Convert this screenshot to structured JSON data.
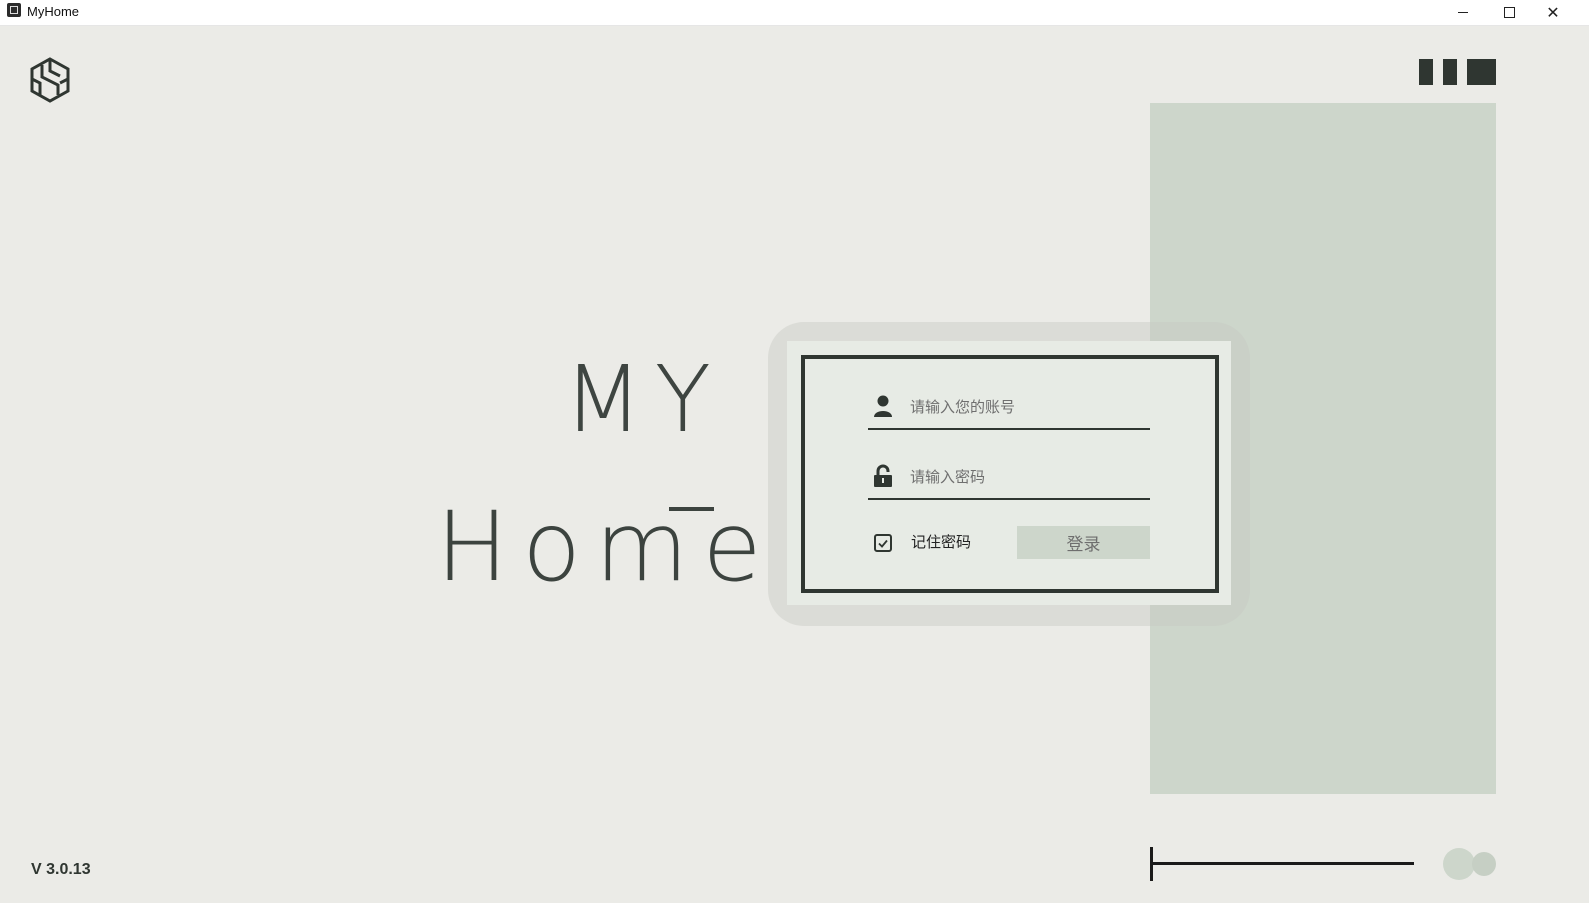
{
  "window": {
    "title": "MyHome",
    "minimize_icon": "minimize-icon",
    "maximize_icon": "maximize-icon",
    "close_glyph": "✕"
  },
  "brand": {
    "logo_icon": "cube-logo-icon",
    "title_line1": "MY",
    "title_line2": "Home"
  },
  "login": {
    "username_placeholder": "请输入您的账号",
    "username_value": "",
    "password_placeholder": "请输入密码",
    "password_value": "",
    "remember_label": "记住密码",
    "remember_checked": true,
    "login_label": "登录"
  },
  "footer": {
    "version": "V 3.0.13"
  },
  "colors": {
    "background": "#ebebe7",
    "accent_dark": "#2f3631",
    "accent_green": "#cdd6cb"
  }
}
